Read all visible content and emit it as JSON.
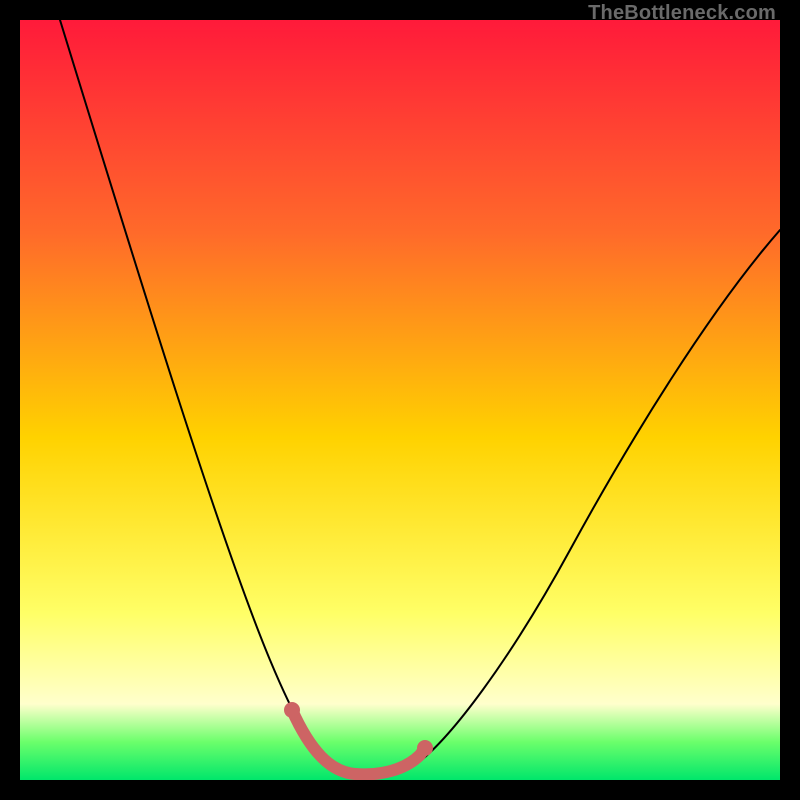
{
  "watermark": "TheBottleneck.com",
  "colors": {
    "bg_black": "#000000",
    "grad_top": "#ff1a3a",
    "grad_mid1": "#ff6a2a",
    "grad_mid2": "#ffd200",
    "grad_mid3": "#ffff66",
    "grad_pale": "#ffffcc",
    "grad_green1": "#6bff6b",
    "grad_green2": "#00e66b",
    "highlight": "#cd6464",
    "curve": "#000000",
    "watermark_color": "#6a6a6a"
  },
  "chart_data": {
    "type": "line",
    "title": "",
    "xlabel": "",
    "ylabel": "",
    "xlim": [
      0,
      100
    ],
    "ylim": [
      0,
      100
    ],
    "x": [
      0,
      5,
      10,
      15,
      20,
      25,
      30,
      32,
      34,
      36,
      38,
      40,
      42,
      44,
      46,
      48,
      50,
      55,
      60,
      65,
      70,
      75,
      80,
      85,
      90,
      95,
      100
    ],
    "series": [
      {
        "name": "bottleneck-curve",
        "values": [
          100,
          85,
          70,
          56,
          43,
          31,
          20,
          15,
          11,
          7,
          4,
          2,
          1,
          0,
          0,
          1,
          2,
          8,
          16,
          25,
          34,
          42,
          49,
          55,
          60,
          64,
          68
        ]
      }
    ],
    "highlight_range_x": [
      32,
      48
    ],
    "annotations": []
  }
}
